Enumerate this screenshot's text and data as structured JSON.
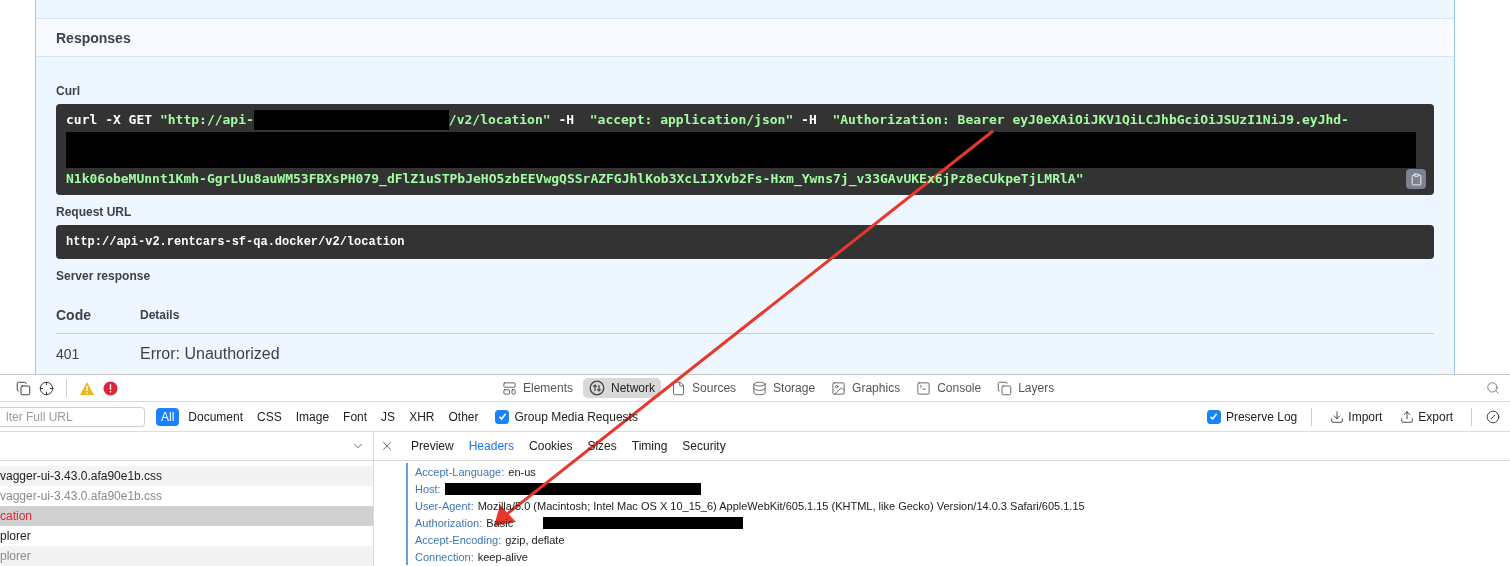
{
  "responses": {
    "title": "Responses",
    "curl": {
      "label": "Curl",
      "lines": [
        {
          "segments": [
            {
              "kind": "text",
              "runs": [
                {
                  "kind": "keyword",
                  "text": "curl -X GET "
                },
                {
                  "kind": "string",
                  "text": "\"http://api-"
                }
              ]
            },
            {
              "kind": "redaction"
            },
            {
              "kind": "text",
              "runs": [
                {
                  "kind": "string",
                  "text": "/v2/location\""
                },
                {
                  "kind": "keyword",
                  "text": " -H  "
                },
                {
                  "kind": "string",
                  "text": "\"accept: application/json\""
                },
                {
                  "kind": "keyword",
                  "text": " -H  "
                },
                {
                  "kind": "string",
                  "text": "\"Authorization: Bearer eyJ0eXAiOiJKV1QiLCJhbGciOiJSUzI1NiJ9.eyJhd-"
                }
              ]
            }
          ]
        },
        {
          "segments": [
            {
              "kind": "redaction_block"
            }
          ]
        },
        {
          "segments": [
            {
              "kind": "text",
              "runs": [
                {
                  "kind": "string",
                  "text": "N1k06obeMUnnt1Kmh-GgrLUu8auWM53FBXsPH079_dFlZ1uSTPbJeHO5zbEEVwgQSSrAZFGJhlKob3XcLIJXvb2Fs-Hxm_Ywns7j_v33GAvUKEx6jPz8eCUkpeTjLMRlA\""
                }
              ]
            }
          ]
        }
      ]
    },
    "request_url": {
      "label": "Request URL",
      "value": "http://api-v2.rentcars-sf-qa.docker/v2/location"
    },
    "server_response": {
      "label": "Server response",
      "columns": [
        "Code",
        "Details"
      ],
      "rows": [
        {
          "code": "401",
          "details": "Error: Unauthorized"
        }
      ]
    }
  },
  "devtools": {
    "tabs": [
      {
        "label": "Elements",
        "selected": false
      },
      {
        "label": "Network",
        "selected": true
      },
      {
        "label": "Sources",
        "selected": false
      },
      {
        "label": "Storage",
        "selected": false
      },
      {
        "label": "Graphics",
        "selected": false
      },
      {
        "label": "Console",
        "selected": false
      },
      {
        "label": "Layers",
        "selected": false
      }
    ],
    "filter": {
      "placeholder": "lter Full URL"
    },
    "types": [
      {
        "label": "All",
        "selected": true
      },
      {
        "label": "Document",
        "selected": false
      },
      {
        "label": "CSS",
        "selected": false
      },
      {
        "label": "Image",
        "selected": false
      },
      {
        "label": "Font",
        "selected": false
      },
      {
        "label": "JS",
        "selected": false
      },
      {
        "label": "XHR",
        "selected": false
      },
      {
        "label": "Other",
        "selected": false
      }
    ],
    "group_media": {
      "label": "Group Media Requests",
      "checked": true
    },
    "preserve_log": {
      "label": "Preserve Log",
      "checked": true
    },
    "actions": [
      {
        "label": "Import"
      },
      {
        "label": "Export"
      }
    ],
    "requests": [
      {
        "name": "vagger-ui-3.43.0.afa90e1b.css",
        "kind": "normal",
        "selected": false
      },
      {
        "name": "vagger-ui-3.43.0.afa90e1b.css",
        "kind": "muted",
        "selected": false
      },
      {
        "name": "cation",
        "kind": "error",
        "selected": true
      },
      {
        "name": "plorer",
        "kind": "normal",
        "selected": false
      },
      {
        "name": "plorer",
        "kind": "muted",
        "selected": false
      }
    ],
    "detail_tabs": [
      {
        "label": "Preview",
        "selected": false
      },
      {
        "label": "Headers",
        "selected": true
      },
      {
        "label": "Cookies",
        "selected": false
      },
      {
        "label": "Sizes",
        "selected": false
      },
      {
        "label": "Timing",
        "selected": false
      },
      {
        "label": "Security",
        "selected": false
      }
    ],
    "headers": [
      {
        "name": "Accept-Language:",
        "value": "en-us",
        "redacted": false
      },
      {
        "name": "Host:",
        "redacted": true
      },
      {
        "name": "User-Agent:",
        "value": "Mozilla/5.0 (Macintosh; Intel Mac OS X 10_15_6) AppleWebKit/605.1.15 (KHTML, like Gecko) Version/14.0.3 Safari/605.1.15",
        "redacted": false
      },
      {
        "name": "Authorization:",
        "value": "Basic",
        "redacted": true
      },
      {
        "name": "Accept-Encoding:",
        "value": "gzip, deflate",
        "redacted": false
      },
      {
        "name": "Connection:",
        "value": "keep-alive",
        "redacted": false
      }
    ]
  }
}
